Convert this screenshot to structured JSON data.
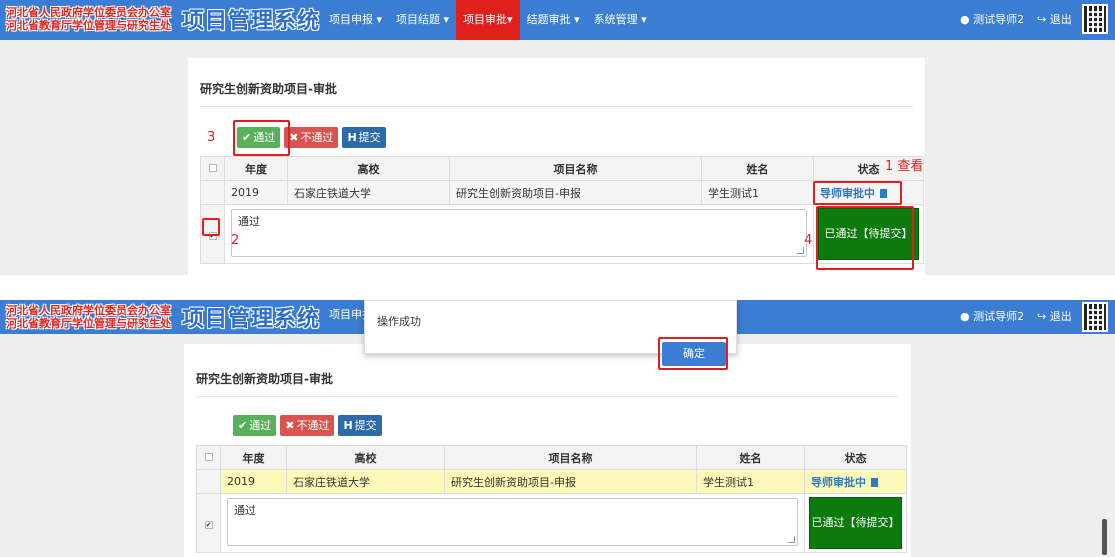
{
  "header": {
    "org_line1": "河北省人民政府学位委员会办公室",
    "org_line2": "河北省教育厅学位管理与研究生处",
    "system_name": "项目管理系统",
    "nav": [
      "项目申报 ▾",
      "项目结题 ▾",
      "项目审批▾",
      "结题审批 ▾",
      "系统管理 ▾"
    ],
    "active_nav": "项目审批",
    "user": "测试导师2",
    "logout": "退出",
    "user_icon": "user-icon",
    "logout_icon": "logout-icon"
  },
  "panel": {
    "title": "研究生创新资助项目-审批",
    "buttons": {
      "pass": "通过",
      "fail": "不通过",
      "submit": "提交",
      "pass_icon": "✔",
      "fail_icon": "✖",
      "submit_icon": "H"
    },
    "table": {
      "headers": [
        "年度",
        "高校",
        "项目名称",
        "姓名",
        "状态"
      ],
      "row": {
        "year": "2019",
        "school": "石家庄铁道大学",
        "project": "研究生创新资助项目-申报",
        "name": "学生测试1",
        "status": "导师审批中"
      },
      "remark": "通过",
      "result": "已通过【待提交】"
    }
  },
  "annotations": {
    "n1": "1 查看",
    "n2": "2",
    "n3": "3",
    "n4": "4"
  },
  "dialog": {
    "message": "操作成功",
    "ok": "确定"
  },
  "colors": {
    "header_blue": "#3a7dd3",
    "active_red": "#e0201a",
    "pass_green": "#58b05a",
    "fail_red": "#d9534f",
    "submit_blue": "#2d6aa8",
    "result_green": "#0d7a0d",
    "annotation_red": "#e02020"
  }
}
